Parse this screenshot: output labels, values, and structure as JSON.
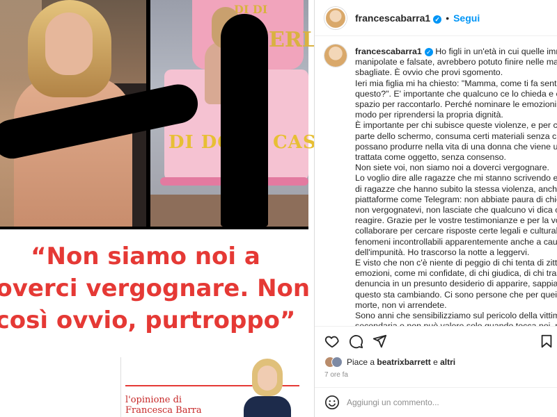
{
  "post": {
    "username": "francescabarra1",
    "follow_label": "Segui",
    "separator": "•",
    "caption_lines": [
      "Ho figli in un'età in cui quelle immagini",
      "manipolate e falsate, avrebbero potuto finire nelle mani",
      "sbagliate. È ovvio che provi sgomento.",
      "Ieri mia figlia mi ha chiesto: \"Mamma, come ti fa sentire tutto",
      "questo?\". E' importante che qualcuno ce lo chieda e che ci dia",
      "spazio per raccontarlo. Perché nominare le emozioni è già un",
      "modo per riprendersi la propria dignità.",
      "È importante per chi subisce queste violenze, e per chi , dall'altra",
      "parte dello schermo, consuma certi materiali senza chiedersi cosa",
      "possano produrre nella vita di una donna che viene usata e",
      "trattata come oggetto, senza consenso.",
      "Non siete voi, non siamo noi a doverci vergognare.",
      "Lo voglio dire alle ragazze che mi stanno scrivendo e ai genitori",
      "di ragazze che hanno subito la stessa violenza, anche su",
      "piattaforme come Telegram: non abbiate paura di chiedere aiuto,",
      "non vergognatevi, non lasciate che qualcuno vi dica come dovete",
      "reagire. Grazie per le vostre testimonianze e per la voglia di",
      "collaborare per cercare risposte certe legali e culturali a questi",
      "fenomeni incontrollabili apparentemente anche a causa",
      "dell'impunità. Ho trascorso la notte a leggervi.",
      "E visto che non c'è niente di peggio di chi tenta di zittire le",
      "emozioni, come mi confidate, di chi giudica, di chi trasforma una",
      "denuncia in un presunto desiderio di apparire, sappiate che",
      "questo sta cambiando. Ci sono persone che per quei giudizi sono",
      "morte, non vi arrendete.",
      "Sono anni che sensibilizziamo sul pericolo della vittimizzazione",
      "secondaria e non può valere solo quando tocca noi, per poi"
    ],
    "likes_prefix": "Piace a",
    "likes_user": "beatrixbarrett",
    "likes_joiner": "e",
    "likes_others": "altri",
    "time_ago": "7 ore fa",
    "comment_placeholder": "Aggiungi un commento..."
  },
  "image": {
    "quote_text": "“Non siamo noi a\ndoverci vergognare. Non è\ncosì ovvio, purtroppo”",
    "cake_text": "DI DONA CASI DI",
    "cake_text_top": "SHERLOCK",
    "cake_text_top2": "DI DI",
    "article_label": "l'opinione di\nFrancesca Barra"
  },
  "colors": {
    "accent_blue": "#0095f6",
    "quote_red": "#e53935"
  }
}
